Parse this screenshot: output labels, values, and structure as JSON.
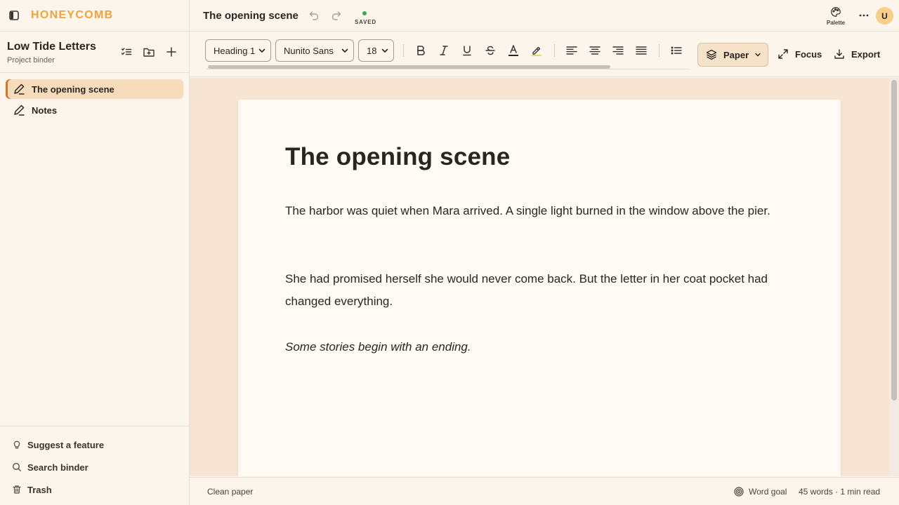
{
  "app": {
    "brand": "HONEYCOMB"
  },
  "project": {
    "title": "Low Tide Letters",
    "subtitle": "Project binder"
  },
  "binder": {
    "items": [
      {
        "label": "The opening scene",
        "active": true
      },
      {
        "label": "Notes",
        "active": false
      }
    ],
    "footer": [
      {
        "label": "Suggest a feature",
        "icon": "lightbulb-icon"
      },
      {
        "label": "Search binder",
        "icon": "search-icon"
      },
      {
        "label": "Trash",
        "icon": "trash-icon"
      }
    ]
  },
  "topbar": {
    "doc_title": "The opening scene",
    "saved_label": "SAVED",
    "palette_label": "Palette",
    "avatar": "U"
  },
  "toolbar": {
    "block_style": "Heading 1",
    "font": "Nunito Sans",
    "size": "18",
    "paper_label": "Paper",
    "focus_label": "Focus",
    "export_label": "Export"
  },
  "document": {
    "heading": "The opening scene",
    "paragraphs": [
      "The harbor was quiet when Mara arrived. A single light burned in the window above the pier.",
      "She had promised herself she would never come back. But the letter in her coat pocket had changed everything.",
      "Some stories begin with an ending."
    ]
  },
  "status": {
    "left": "Clean paper",
    "word_goal": "Word goal",
    "stats": "45 words · 1 min read"
  },
  "colors": {
    "brand": "#efa43b",
    "accent": "#c97a2a",
    "active_bg": "#f7dcbc",
    "saved": "#3da35a"
  }
}
